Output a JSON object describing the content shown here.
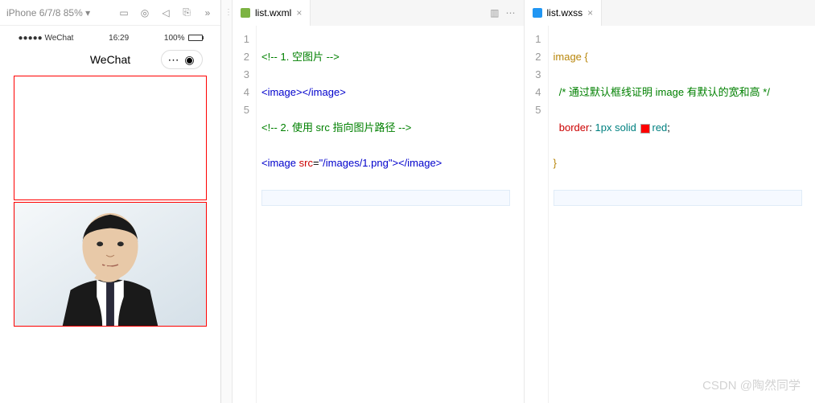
{
  "simulator": {
    "device_label": "iPhone 6/7/8 85%",
    "status_left": "●●●●● WeChat",
    "status_time": "16:29",
    "status_pct": "100%",
    "nav_title": "WeChat"
  },
  "editor1": {
    "filename": "list.wxml",
    "lines": [
      "1",
      "2",
      "3",
      "4",
      "5"
    ],
    "code": {
      "l1_open": "<!-- ",
      "l1_text": "1. 空图片 ",
      "l1_close": "-->",
      "l2_open": "<image>",
      "l2_close": "</image>",
      "l3_open": "<!-- ",
      "l3_text": "2. 使用 src 指向图片路径 ",
      "l3_close": "-->",
      "l4_open": "<image ",
      "l4_attr": "src",
      "l4_eq": "=",
      "l4_val": "\"/images/1.png\"",
      "l4_gt": ">",
      "l4_close": "</image>"
    }
  },
  "editor2": {
    "filename": "list.wxss",
    "lines": [
      "1",
      "2",
      "3",
      "4",
      "5"
    ],
    "code": {
      "l1_sel": "image ",
      "l1_brace": "{",
      "l2_open": "/* ",
      "l2_text": "通过默认框线证明 image 有默认的宽和高",
      "l2_close": " */",
      "l3_prop": "border",
      "l3_colon": ": ",
      "l3_v1": "1px ",
      "l3_v2": "solid ",
      "l3_v3": "red",
      "l3_semi": ";",
      "l4_brace": "}"
    }
  },
  "watermark": "CSDN @陶然同学"
}
